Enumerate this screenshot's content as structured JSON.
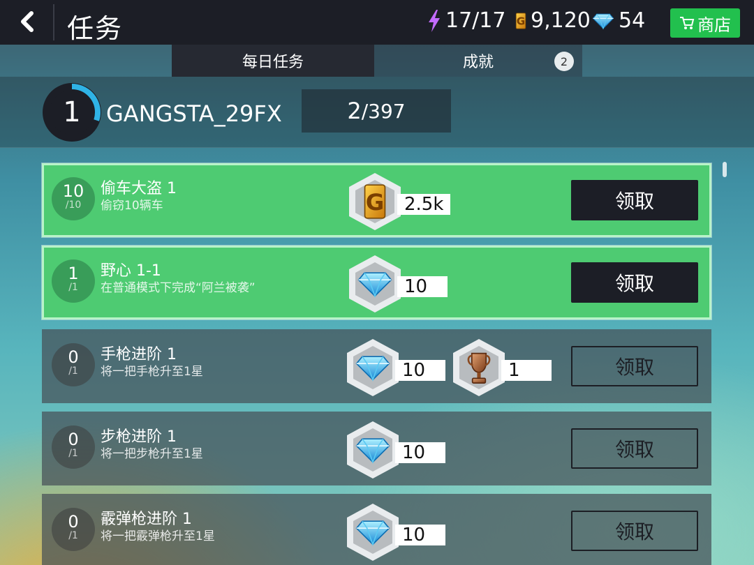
{
  "header": {
    "title": "任务",
    "energy": "17/17",
    "coins": "9,120",
    "gems": "54",
    "shop_label": "商店"
  },
  "tabs": {
    "daily": "每日任务",
    "achievements": "成就",
    "achievements_badge": "2"
  },
  "player": {
    "level": "1",
    "name": "GANGSTA_29FX",
    "progress_current": "2",
    "progress_total": "/397",
    "level_progress": 0.3
  },
  "quests": [
    {
      "count": "10",
      "total": "/10",
      "title": "偷车大盗 1",
      "desc": "偷窃10辆车",
      "reward_icon": "coin-icon",
      "reward": "2.5k",
      "claim": "领取",
      "done": true
    },
    {
      "count": "1",
      "total": "/1",
      "title": "野心 1-1",
      "desc": "在普通模式下完成“阿兰被袭”",
      "reward_icon": "gem-icon",
      "reward": "10",
      "claim": "领取",
      "done": true
    },
    {
      "count": "0",
      "total": "/1",
      "title": "手枪进阶 1",
      "desc": "将一把手枪升至1星",
      "reward_icon": "gem-icon",
      "reward": "10",
      "reward2_icon": "trophy-icon",
      "reward2": "1",
      "claim": "领取",
      "done": false
    },
    {
      "count": "0",
      "total": "/1",
      "title": "步枪进阶 1",
      "desc": "将一把步枪升至1星",
      "reward_icon": "gem-icon",
      "reward": "10",
      "claim": "领取",
      "done": false
    },
    {
      "count": "0",
      "total": "/1",
      "title": "霰弹枪进阶 1",
      "desc": "将一把霰弹枪升至1星",
      "reward_icon": "gem-icon",
      "reward": "10",
      "claim": "领取",
      "done": false
    }
  ],
  "colors": {
    "done_card": "#4ecb72",
    "accent_blue": "#2fb3e6",
    "shop_green": "#22c04e",
    "topbar": "#1c1e26"
  }
}
